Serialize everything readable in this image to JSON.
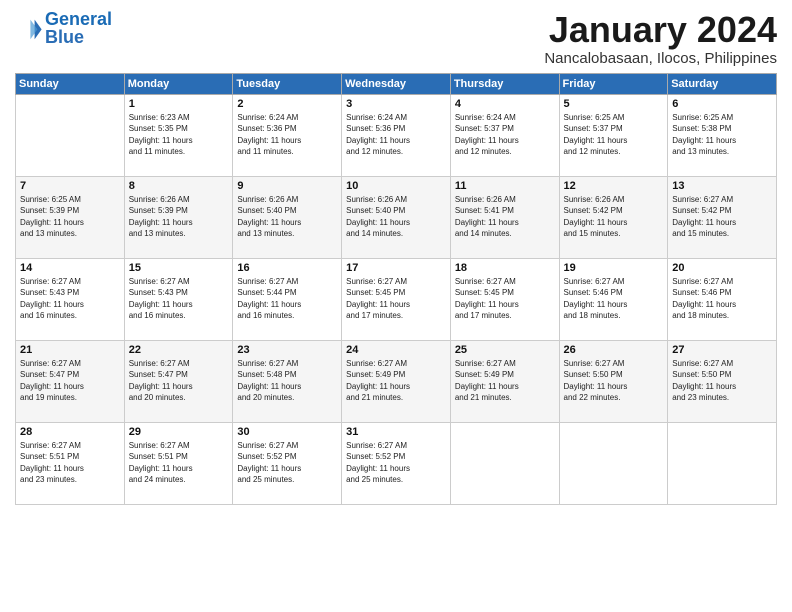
{
  "logo": {
    "line1": "General",
    "line2": "Blue"
  },
  "title": "January 2024",
  "location": "Nancalobasaan, Ilocos, Philippines",
  "days_header": [
    "Sunday",
    "Monday",
    "Tuesday",
    "Wednesday",
    "Thursday",
    "Friday",
    "Saturday"
  ],
  "weeks": [
    [
      {
        "num": "",
        "info": ""
      },
      {
        "num": "1",
        "info": "Sunrise: 6:23 AM\nSunset: 5:35 PM\nDaylight: 11 hours\nand 11 minutes."
      },
      {
        "num": "2",
        "info": "Sunrise: 6:24 AM\nSunset: 5:36 PM\nDaylight: 11 hours\nand 11 minutes."
      },
      {
        "num": "3",
        "info": "Sunrise: 6:24 AM\nSunset: 5:36 PM\nDaylight: 11 hours\nand 12 minutes."
      },
      {
        "num": "4",
        "info": "Sunrise: 6:24 AM\nSunset: 5:37 PM\nDaylight: 11 hours\nand 12 minutes."
      },
      {
        "num": "5",
        "info": "Sunrise: 6:25 AM\nSunset: 5:37 PM\nDaylight: 11 hours\nand 12 minutes."
      },
      {
        "num": "6",
        "info": "Sunrise: 6:25 AM\nSunset: 5:38 PM\nDaylight: 11 hours\nand 13 minutes."
      }
    ],
    [
      {
        "num": "7",
        "info": "Sunrise: 6:25 AM\nSunset: 5:39 PM\nDaylight: 11 hours\nand 13 minutes."
      },
      {
        "num": "8",
        "info": "Sunrise: 6:26 AM\nSunset: 5:39 PM\nDaylight: 11 hours\nand 13 minutes."
      },
      {
        "num": "9",
        "info": "Sunrise: 6:26 AM\nSunset: 5:40 PM\nDaylight: 11 hours\nand 13 minutes."
      },
      {
        "num": "10",
        "info": "Sunrise: 6:26 AM\nSunset: 5:40 PM\nDaylight: 11 hours\nand 14 minutes."
      },
      {
        "num": "11",
        "info": "Sunrise: 6:26 AM\nSunset: 5:41 PM\nDaylight: 11 hours\nand 14 minutes."
      },
      {
        "num": "12",
        "info": "Sunrise: 6:26 AM\nSunset: 5:42 PM\nDaylight: 11 hours\nand 15 minutes."
      },
      {
        "num": "13",
        "info": "Sunrise: 6:27 AM\nSunset: 5:42 PM\nDaylight: 11 hours\nand 15 minutes."
      }
    ],
    [
      {
        "num": "14",
        "info": "Sunrise: 6:27 AM\nSunset: 5:43 PM\nDaylight: 11 hours\nand 16 minutes."
      },
      {
        "num": "15",
        "info": "Sunrise: 6:27 AM\nSunset: 5:43 PM\nDaylight: 11 hours\nand 16 minutes."
      },
      {
        "num": "16",
        "info": "Sunrise: 6:27 AM\nSunset: 5:44 PM\nDaylight: 11 hours\nand 16 minutes."
      },
      {
        "num": "17",
        "info": "Sunrise: 6:27 AM\nSunset: 5:45 PM\nDaylight: 11 hours\nand 17 minutes."
      },
      {
        "num": "18",
        "info": "Sunrise: 6:27 AM\nSunset: 5:45 PM\nDaylight: 11 hours\nand 17 minutes."
      },
      {
        "num": "19",
        "info": "Sunrise: 6:27 AM\nSunset: 5:46 PM\nDaylight: 11 hours\nand 18 minutes."
      },
      {
        "num": "20",
        "info": "Sunrise: 6:27 AM\nSunset: 5:46 PM\nDaylight: 11 hours\nand 18 minutes."
      }
    ],
    [
      {
        "num": "21",
        "info": "Sunrise: 6:27 AM\nSunset: 5:47 PM\nDaylight: 11 hours\nand 19 minutes."
      },
      {
        "num": "22",
        "info": "Sunrise: 6:27 AM\nSunset: 5:47 PM\nDaylight: 11 hours\nand 20 minutes."
      },
      {
        "num": "23",
        "info": "Sunrise: 6:27 AM\nSunset: 5:48 PM\nDaylight: 11 hours\nand 20 minutes."
      },
      {
        "num": "24",
        "info": "Sunrise: 6:27 AM\nSunset: 5:49 PM\nDaylight: 11 hours\nand 21 minutes."
      },
      {
        "num": "25",
        "info": "Sunrise: 6:27 AM\nSunset: 5:49 PM\nDaylight: 11 hours\nand 21 minutes."
      },
      {
        "num": "26",
        "info": "Sunrise: 6:27 AM\nSunset: 5:50 PM\nDaylight: 11 hours\nand 22 minutes."
      },
      {
        "num": "27",
        "info": "Sunrise: 6:27 AM\nSunset: 5:50 PM\nDaylight: 11 hours\nand 23 minutes."
      }
    ],
    [
      {
        "num": "28",
        "info": "Sunrise: 6:27 AM\nSunset: 5:51 PM\nDaylight: 11 hours\nand 23 minutes."
      },
      {
        "num": "29",
        "info": "Sunrise: 6:27 AM\nSunset: 5:51 PM\nDaylight: 11 hours\nand 24 minutes."
      },
      {
        "num": "30",
        "info": "Sunrise: 6:27 AM\nSunset: 5:52 PM\nDaylight: 11 hours\nand 25 minutes."
      },
      {
        "num": "31",
        "info": "Sunrise: 6:27 AM\nSunset: 5:52 PM\nDaylight: 11 hours\nand 25 minutes."
      },
      {
        "num": "",
        "info": ""
      },
      {
        "num": "",
        "info": ""
      },
      {
        "num": "",
        "info": ""
      }
    ]
  ]
}
